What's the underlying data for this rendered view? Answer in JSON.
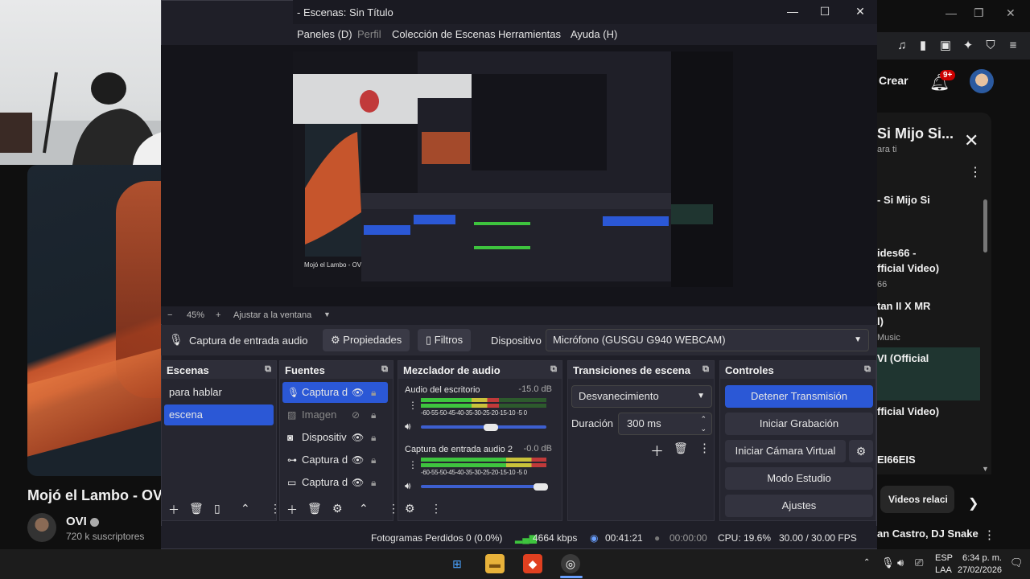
{
  "colors": {
    "accent": "#2b58d6",
    "meter_green": "#3ec43e",
    "meter_yellow": "#c9c23a",
    "meter_red": "#c03a3a",
    "yt_red": "#cc0000"
  },
  "youtube": {
    "video_title": "Mojó el Lambo - OV",
    "channel": "OVI",
    "subscribers": "720 k suscriptores",
    "create_label": "Crear",
    "notifications": "9+",
    "panel_title": "Si Mijo Si...",
    "panel_sub": "ara ti",
    "items": [
      {
        "title": "- Si Mijo Si",
        "sub": ""
      },
      {
        "title": "ides66 -",
        "sub": ""
      },
      {
        "title": "fficial Video)",
        "sub": "66"
      },
      {
        "title": "tan II X MR",
        "sub": ""
      },
      {
        "title": "l)",
        "sub": "Music"
      },
      {
        "title": "VI (Official",
        "sub": ""
      },
      {
        "title": "fficial Video)",
        "sub": ""
      },
      {
        "title": "EI66EIS",
        "sub": ""
      }
    ],
    "related_label": "Videos relaci",
    "bottom_text": "an Castro, DJ Snake"
  },
  "obs": {
    "title": "- Escenas: Sin Título",
    "menu": [
      "Paneles (D)",
      "Perfil",
      "Colección de Escenas",
      "Herramientas",
      "Ayuda (H)"
    ],
    "zoom": {
      "minus": "−",
      "value": "45%",
      "plus": "+",
      "fit": "Ajustar a la ventana"
    },
    "source_bar": {
      "source_name": "Captura de entrada audio 2",
      "properties": "Propiedades",
      "filters": "Filtros",
      "device_label": "Dispositivo",
      "device_value": "Micrófono (GUSGU G940 WEBCAM)"
    },
    "scenes": {
      "title": "Escenas",
      "items": [
        "para hablar",
        "escena"
      ],
      "selected": 1
    },
    "sources": {
      "title": "Fuentes",
      "items": [
        "Captura d",
        "Imagen",
        "Dispositiv",
        "Captura d",
        "Captura d"
      ],
      "icons": [
        "mic-icon",
        "image-icon",
        "camera-icon",
        "gamepad-icon",
        "monitor-icon"
      ]
    },
    "mixer": {
      "title": "Mezclador de audio",
      "channels": [
        {
          "name": "Audio del escritorio",
          "db": "-15.0 dB",
          "level": 0.62
        },
        {
          "name": "Captura de entrada audio 2",
          "db": "-0.0 dB",
          "level": 1.0
        }
      ],
      "scale": "-60-55-50-45-40-35-30-25-20-15-10 -5 0"
    },
    "transitions": {
      "title": "Transiciones de escena",
      "type": "Desvanecimiento",
      "duration_label": "Duración",
      "duration_value": "300 ms"
    },
    "controls": {
      "title": "Controles",
      "buttons": [
        "Detener Transmisión",
        "Iniciar Grabación",
        "Iniciar Cámara Virtual",
        "Modo Estudio",
        "Ajustes"
      ]
    },
    "status": {
      "dropped": "Fotogramas Perdidos 0 (0.0%)",
      "bitrate": "4664 kbps",
      "stream_time": "00:41:21",
      "rec_time": "00:00:00",
      "cpu": "CPU: 19.6%",
      "fps": "30.00 / 30.00 FPS"
    }
  },
  "taskbar": {
    "lang": "ESP",
    "layout": "LAA",
    "time": "6:34 p. m.",
    "date": "27/02/2026"
  }
}
